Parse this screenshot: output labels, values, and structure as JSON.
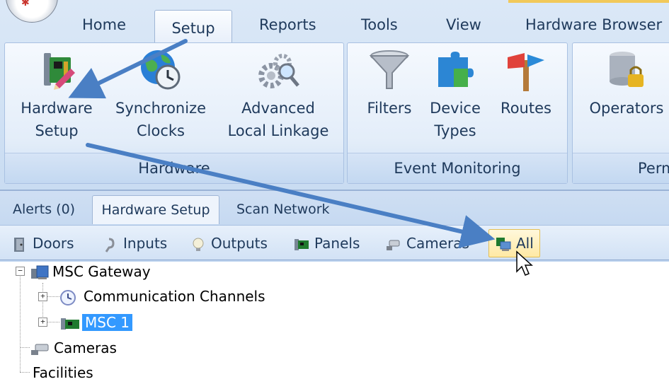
{
  "ribbon": {
    "tabs": [
      {
        "label": "Home"
      },
      {
        "label": "Setup"
      },
      {
        "label": "Reports"
      },
      {
        "label": "Tools"
      },
      {
        "label": "View"
      },
      {
        "label": "Hardware Browser"
      }
    ],
    "active_tab": "Setup",
    "groups": {
      "hardware": {
        "label": "Hardware",
        "buttons": [
          {
            "line1": "Hardware",
            "line2": "Setup",
            "icon": "hardware-setup-icon"
          },
          {
            "line1": "Synchronize",
            "line2": "Clocks",
            "icon": "globe-clock-icon"
          },
          {
            "line1": "Advanced",
            "line2": "Local Linkage",
            "icon": "gears-magnifier-icon"
          }
        ]
      },
      "event_monitoring": {
        "label": "Event Monitoring",
        "buttons": [
          {
            "line1": "Filters",
            "line2": "",
            "icon": "funnel-icon"
          },
          {
            "line1": "Device",
            "line2": "Types",
            "icon": "puzzle-icon"
          },
          {
            "line1": "Routes",
            "line2": "",
            "icon": "signpost-icon"
          }
        ]
      },
      "permissions": {
        "label": "Perm",
        "buttons": [
          {
            "line1": "Operators",
            "line2": "",
            "icon": "database-lock-icon"
          }
        ]
      }
    }
  },
  "doc_tabs": [
    {
      "label": "Alerts (0)"
    },
    {
      "label": "Hardware Setup"
    },
    {
      "label": "Scan Network"
    }
  ],
  "toolbar": [
    {
      "label": "Doors",
      "icon": "door-icon"
    },
    {
      "label": "Inputs",
      "icon": "input-icon"
    },
    {
      "label": "Outputs",
      "icon": "lightbulb-icon"
    },
    {
      "label": "Panels",
      "icon": "panel-board-icon"
    },
    {
      "label": "Cameras",
      "icon": "camera-icon"
    },
    {
      "label": "All",
      "icon": "all-devices-icon"
    }
  ],
  "tree": {
    "root": "MSC Gateway",
    "child1": "Communication Channels",
    "child2": "MSC 1",
    "cameras": "Cameras",
    "facilities": "Facilities"
  },
  "colors": {
    "accent": "#3399ff",
    "arrow": "#4a7fc4",
    "text": "#1e395b"
  }
}
